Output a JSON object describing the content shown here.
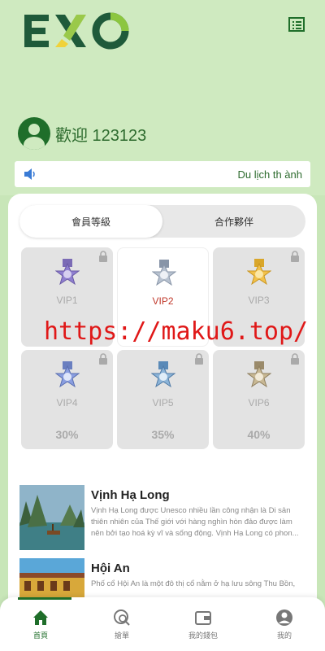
{
  "brand": {
    "logo_text": "EXO",
    "accent": "#1f6e2a"
  },
  "header": {
    "welcome": "歡迎 123123",
    "menu_icon": "list-icon"
  },
  "notice": {
    "icon": "speaker-icon",
    "text": "Du lịch th ành"
  },
  "tabs": [
    {
      "label": "會員等級",
      "active": true
    },
    {
      "label": "合作夥伴",
      "active": false
    }
  ],
  "vips": [
    {
      "name": "VIP1",
      "percent": "",
      "locked": true
    },
    {
      "name": "VIP2",
      "percent": "",
      "locked": false
    },
    {
      "name": "VIP3",
      "percent": "",
      "locked": true
    },
    {
      "name": "VIP4",
      "percent": "30%",
      "locked": true
    },
    {
      "name": "VIP5",
      "percent": "35%",
      "locked": true
    },
    {
      "name": "VIP6",
      "percent": "40%",
      "locked": true
    }
  ],
  "watermark": "https://maku6.top/",
  "places": [
    {
      "title": "Vịnh Hạ Long",
      "description": "Vịnh Hạ Long được Unesco nhiều lần công nhận là Di sản thiên nhiên của Thế giới với hàng nghìn hòn đảo được làm nên bởi tạo hoá kỳ vĩ và sống động. Vịnh Hạ Long có phon..."
    },
    {
      "title": "Hội An",
      "description": "Phố cổ Hội An là một đô thị cổ nằm ở hạ lưu sông Thu Bồn,"
    }
  ],
  "nav": [
    {
      "label": "首頁",
      "icon": "home-icon",
      "active": true
    },
    {
      "label": "搶單",
      "icon": "search-globe-icon",
      "active": false
    },
    {
      "label": "我的錢包",
      "icon": "wallet-icon",
      "active": false
    },
    {
      "label": "我的",
      "icon": "user-icon",
      "active": false
    }
  ]
}
